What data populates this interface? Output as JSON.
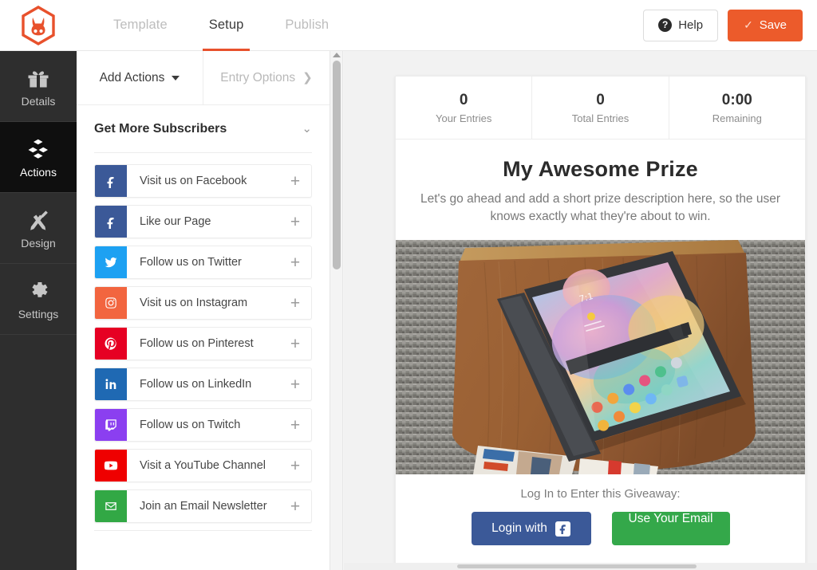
{
  "brand": {
    "logo_name": "rafflepress-rabbit-logo",
    "accent_color": "#e8512c",
    "save_color": "#ec5b2b"
  },
  "topbar": {
    "tabs": [
      {
        "label": "Template",
        "active": false
      },
      {
        "label": "Setup",
        "active": true
      },
      {
        "label": "Publish",
        "active": false
      }
    ],
    "help_label": "Help",
    "help_icon": "question-circle-icon",
    "save_label": "Save",
    "save_icon": "check-icon"
  },
  "sidebar": {
    "items": [
      {
        "label": "Details",
        "icon": "gift-icon",
        "active": false
      },
      {
        "label": "Actions",
        "icon": "blocks-icon",
        "active": true
      },
      {
        "label": "Design",
        "icon": "brush-pencil-icon",
        "active": false
      },
      {
        "label": "Settings",
        "icon": "gear-icon",
        "active": false
      }
    ]
  },
  "panel": {
    "tabs": [
      {
        "label": "Add Actions",
        "icon": "chevron-down-icon",
        "state": "primary"
      },
      {
        "label": "Entry Options",
        "icon": "chevron-right-icon",
        "state": "muted"
      }
    ],
    "group": {
      "title": "Get More Subscribers",
      "collapse_icon": "chevron-down-icon"
    },
    "actions": [
      {
        "label": "Visit us on Facebook",
        "icon": "facebook-icon",
        "color": "#3b5998",
        "add_icon": "plus-icon"
      },
      {
        "label": "Like our Page",
        "icon": "facebook-icon",
        "color": "#3b5998",
        "add_icon": "plus-icon"
      },
      {
        "label": "Follow us on Twitter",
        "icon": "twitter-icon",
        "color": "#1da1f2",
        "add_icon": "plus-icon"
      },
      {
        "label": "Visit us on Instagram",
        "icon": "instagram-icon",
        "color": "#f2653f",
        "add_icon": "plus-icon"
      },
      {
        "label": "Follow us on Pinterest",
        "icon": "pinterest-icon",
        "color": "#e60023",
        "add_icon": "plus-icon"
      },
      {
        "label": "Follow us on LinkedIn",
        "icon": "linkedin-icon",
        "color": "#1f69b3",
        "add_icon": "plus-icon"
      },
      {
        "label": "Follow us on Twitch",
        "icon": "twitch-icon",
        "color": "#8b3ff0",
        "add_icon": "plus-icon"
      },
      {
        "label": "Visit a YouTube Channel",
        "icon": "youtube-icon",
        "color": "#ef0000",
        "add_icon": "plus-icon"
      },
      {
        "label": "Join an Email Newsletter",
        "icon": "envelope-icon",
        "color": "#32a845",
        "add_icon": "plus-icon"
      }
    ]
  },
  "preview": {
    "stats": [
      {
        "value": "0",
        "label": "Your Entries"
      },
      {
        "value": "0",
        "label": "Total Entries"
      },
      {
        "value": "0:00",
        "label": "Remaining"
      }
    ],
    "prize_title": "My Awesome Prize",
    "prize_description": "Let's go ahead and add a short prize description here, so the user knows exactly what they're about to win.",
    "prize_image_alt": "tablet-with-stylus-on-wooden-table-photo",
    "login_prompt": "Log In to Enter this Giveaway:",
    "login_facebook_label": "Login with",
    "login_facebook_icon": "facebook-icon",
    "login_email_label": "Use Your Email"
  }
}
